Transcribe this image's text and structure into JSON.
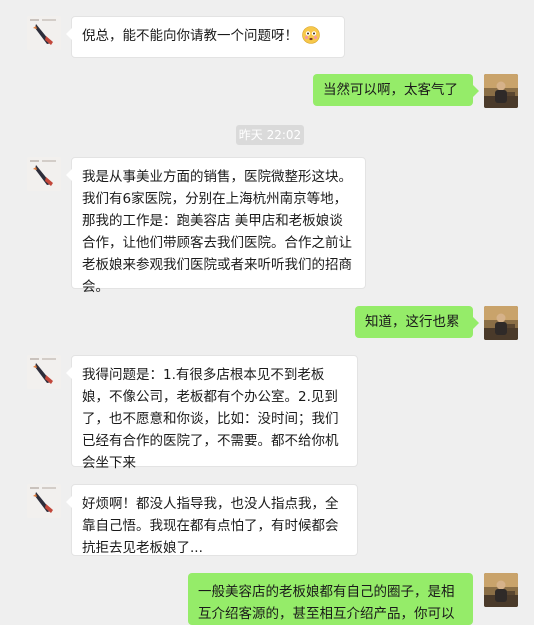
{
  "messages": [
    {
      "text": "倪总，能不能向你请教一个问题呀！",
      "emoji": "flushed-face-emoji"
    },
    {
      "text": "当然可以啊，太客气了"
    },
    {
      "text": "我是从事美业方面的销售，医院微整形这块。我们有6家医院，分别在上海杭州南京等地，那我的工作是：跑美容店 美甲店和老板娘谈合作，让他们带顾客去我们医院。合作之前让老板娘来参观我们医院或者来听听我们的招商会。"
    },
    {
      "text": "知道，这行也累"
    },
    {
      "text": "我得问题是：1.有很多店根本见不到老板娘，不像公司，老板都有个办公室。2.见到了，也不愿意和你谈，比如：没时间；我们已经有合作的医院了，不需要。都不给你机会坐下来"
    },
    {
      "text": "好烦啊！都没人指导我，也没人指点我，全靠自己悟。我现在都有点怕了，有时候都会抗拒去见老板娘了..."
    },
    {
      "text": "一般美容店的老板娘都有自己的圈子，是相互介绍客源的，甚至相互介绍产品，你可以"
    }
  ],
  "timestamp": "昨天 22:02",
  "colors": {
    "background": "#efefef",
    "incoming": "#ffffff",
    "outgoing": "#95ec69",
    "timestamp_bg": "#dadada"
  },
  "icons": {
    "contact_avatar": "avatar-contact",
    "self_avatar": "avatar-self",
    "emoji": "flushed-face-emoji"
  }
}
